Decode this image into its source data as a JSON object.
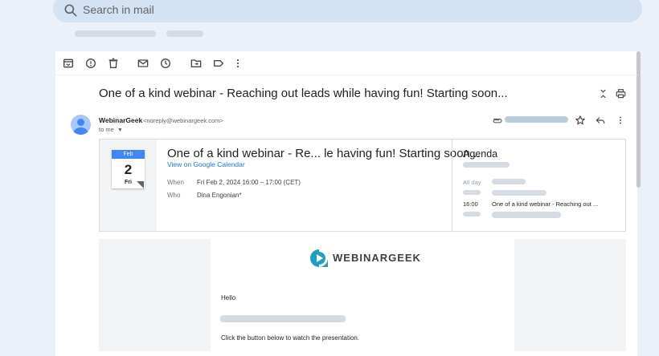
{
  "search": {
    "placeholder": "Search in mail"
  },
  "email": {
    "subject": "One of a kind webinar - Reaching out leads while having fun! Starting soon...",
    "sender_name": "WebinarGeek",
    "sender_email": "<noreply@webinargeek.com>",
    "to_label": "to me"
  },
  "event": {
    "month": "Feb",
    "day": "2",
    "weekday": "Fri",
    "title": "One of a kind webinar - Re... le having fun! Starting soon...",
    "calendar_link": "View on Google Calendar",
    "when_label": "When",
    "when_value": "Fri Feb 2, 2024 16:00 – 17:00 (CET)",
    "who_label": "Who",
    "who_value": "Dina Engonian*"
  },
  "agenda": {
    "title": "Agenda",
    "all_day_label": "All day",
    "time": "16:00",
    "event_text": "One of a kind webinar - Reaching out ..."
  },
  "body": {
    "brand": "WEBINARGEEK",
    "greeting": "Hello",
    "instruction": "Click the button below to watch the presentation."
  },
  "colors": {
    "accent": "#1a73e8",
    "calendar_blue": "#4285f4",
    "brand_teal": "#1f9fbf",
    "background": "#eaf1fb"
  },
  "icons": [
    "search-icon",
    "archive-icon",
    "report-spam-icon",
    "delete-icon",
    "mark-unread-icon",
    "snooze-icon",
    "move-to-icon",
    "label-icon",
    "more-vert-icon",
    "expand-collapse-icon",
    "print-icon",
    "attachment-icon",
    "star-icon",
    "reply-icon"
  ]
}
